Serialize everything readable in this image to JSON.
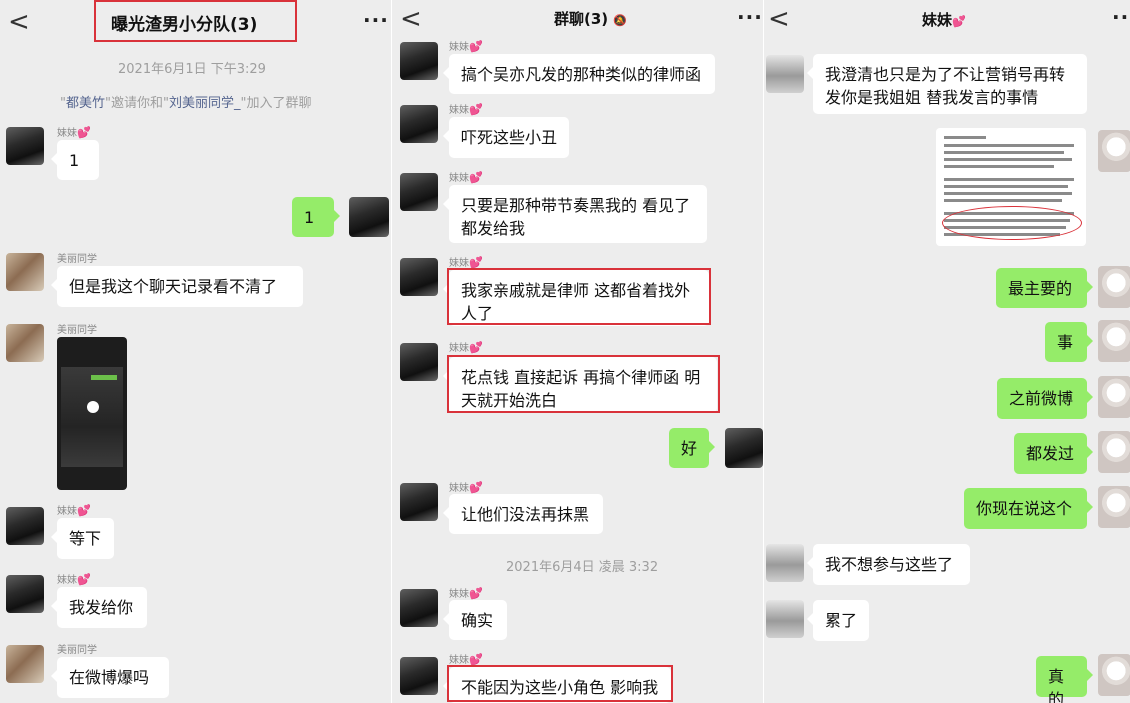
{
  "panel1": {
    "back": "<",
    "title": "曝光渣男小分队(3)",
    "more": "···",
    "timestamp": "2021年6月1日 下午3:29",
    "system": {
      "q1": "\"",
      "inviter": "都美竹",
      "mid": "\"邀请你和\"",
      "invitee": "刘美丽同学_",
      "tail": "\"加入了群聊"
    },
    "messages": [
      {
        "name": "妹妹",
        "text": "1"
      },
      {
        "text": "1"
      },
      {
        "name": "美丽同学",
        "text": "但是我这个聊天记录看不清了"
      },
      {
        "name": "美丽同学"
      },
      {
        "name": "妹妹",
        "text": "等下"
      },
      {
        "name": "妹妹",
        "text": "我发给你"
      },
      {
        "name": "美丽同学",
        "text": "在微博爆吗"
      }
    ]
  },
  "panel2": {
    "back": "<",
    "title": "群聊(3)",
    "more": "···",
    "timestamp": "2021年6月4日 凌晨 3:32",
    "messages": [
      {
        "name": "妹妹",
        "text": "搞个吴亦凡发的那种类似的律师函"
      },
      {
        "name": "妹妹",
        "text": "吓死这些小丑"
      },
      {
        "name": "妹妹",
        "line1": "只要是那种带节奏黑我的 看见了",
        "line2": "都发给我"
      },
      {
        "name": "妹妹",
        "line1": "我家亲戚就是律师 这都省着找外",
        "line2": "人了"
      },
      {
        "name": "妹妹",
        "line1": "花点钱 直接起诉 再搞个律师函 明",
        "line2": "天就开始洗白"
      },
      {
        "text": "好"
      },
      {
        "name": "妹妹",
        "text": "让他们没法再抹黑"
      },
      {
        "name": "妹妹",
        "text": "确实"
      },
      {
        "name": "妹妹",
        "text": "不能因为这些小角色 影响我"
      }
    ]
  },
  "panel3": {
    "back": "<",
    "title": "妹妹",
    "more": "···",
    "messages": [
      {
        "line1": "我澄清也只是为了不让营销号再转",
        "line2": "发你是我姐姐 替我发言的事情"
      },
      {
        "text": "最主要的"
      },
      {
        "text": "事"
      },
      {
        "text": "之前微博"
      },
      {
        "text": "都发过"
      },
      {
        "text": "你现在说这个"
      },
      {
        "text": "我不想参与这些了"
      },
      {
        "text": "累了"
      },
      {
        "text": "真的"
      }
    ]
  },
  "icons": {
    "heart": "💕"
  },
  "colors": {
    "background": "#ededed",
    "outgoing": "#95ec69",
    "incoming": "#ffffff",
    "highlight": "#d9323a",
    "link": "#55658f"
  }
}
